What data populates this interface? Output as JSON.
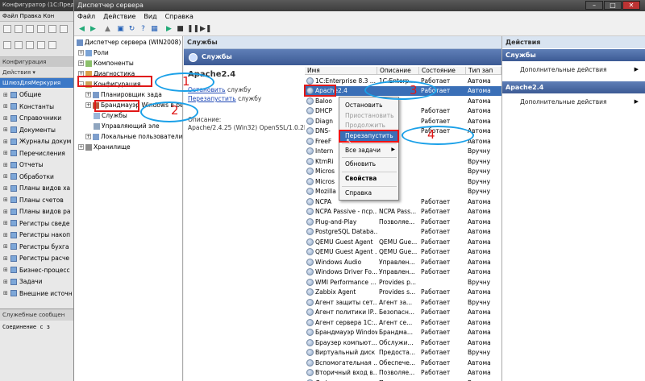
{
  "onec": {
    "title1": "Конфигуратор (1С:Предприятие)",
    "title2": "Файл Правка Кон",
    "panel_header": "Конфигурация",
    "actions_label": "Действия ▾",
    "selected": "ШлюзДляМеркурия",
    "items": [
      "Общие",
      "Константы",
      "Справочники",
      "Документы",
      "Журналы докум",
      "Перечисления",
      "Отчеты",
      "Обработки",
      "Планы видов ха",
      "Планы счетов",
      "Планы видов ра",
      "Регистры сведе",
      "Регистры накоп",
      "Регистры бухга",
      "Регистры расче",
      "Бизнес-процесс",
      "Задачи",
      "Внешние источн"
    ],
    "messages_header": "Служебные сообщен",
    "messages_text": "Соединение с з"
  },
  "window": {
    "title": "Диспетчер сервера",
    "menu": [
      "Файл",
      "Действие",
      "Вид",
      "Справка"
    ],
    "min": "–",
    "max": "□",
    "close": "✕"
  },
  "tree": {
    "root": "Диспетчер сервера (WIN2008)",
    "roles": "Роли",
    "components": "Компоненты",
    "diagnostics": "Диагностика",
    "configuration": "Конфигурация",
    "scheduler": "Планировщик зада",
    "firewall": "Брандмауэр Windows в ре",
    "services": "Службы",
    "wmi": "Управляющий эле",
    "local_users": "Локальные пользователи",
    "storage": "Хранилище"
  },
  "middle": {
    "header": "Службы",
    "bar": "Службы",
    "service_name": "Apache2.4",
    "stop_link": "Остановить",
    "stop_suffix": " службу",
    "restart_link": "Перезапустить",
    "restart_suffix": " службу",
    "desc_label": "Описание:",
    "desc_value": "Apache/2.4.25 (Win32) OpenSSL/1.0.2k"
  },
  "columns": [
    "Имя",
    "Описание",
    "Состояние",
    "Тип зап"
  ],
  "services": [
    {
      "name": "1C:Enterprise 8.3 ...",
      "desc": "1C:Enterp...",
      "state": "Работает",
      "type": "Автома"
    },
    {
      "name": "Apache2.4",
      "desc": "",
      "state": "Работает",
      "type": "Автома"
    },
    {
      "name": "Baloo",
      "desc": "",
      "state": "",
      "type": "Автома"
    },
    {
      "name": "DHCP",
      "desc": "",
      "state": "Работает",
      "type": "Автома"
    },
    {
      "name": "Diagn",
      "desc": "",
      "state": "Работает",
      "type": "Автома"
    },
    {
      "name": "DNS-",
      "desc": "",
      "state": "Работает",
      "type": "Автома"
    },
    {
      "name": "FreeF",
      "desc": "",
      "state": "",
      "type": "Автома"
    },
    {
      "name": "Intern",
      "desc": "",
      "state": "",
      "type": "Вручну"
    },
    {
      "name": "KtmRi",
      "desc": "",
      "state": "",
      "type": "Вручну"
    },
    {
      "name": "Micros",
      "desc": "",
      "state": "",
      "type": "Вручну"
    },
    {
      "name": "Micros",
      "desc": "",
      "state": "",
      "type": "Вручну"
    },
    {
      "name": "Mozilla",
      "desc": "",
      "state": "",
      "type": "Вручну"
    },
    {
      "name": "NCPA",
      "desc": "",
      "state": "Работает",
      "type": "Автома"
    },
    {
      "name": "NCPA Passive - пср...",
      "desc": "NCPA Pass...",
      "state": "Работает",
      "type": "Автома"
    },
    {
      "name": "Plug-and-Play",
      "desc": "Позволяе...",
      "state": "Работает",
      "type": "Автома"
    },
    {
      "name": "PostgreSQL Databa...",
      "desc": "",
      "state": "Работает",
      "type": "Автома"
    },
    {
      "name": "QEMU Guest Agent",
      "desc": "QEMU Gue...",
      "state": "Работает",
      "type": "Автома"
    },
    {
      "name": "QEMU Guest Agent ...",
      "desc": "QEMU Gue...",
      "state": "Работает",
      "type": "Автома"
    },
    {
      "name": "Windows Audio",
      "desc": "Управлен...",
      "state": "Работает",
      "type": "Автома"
    },
    {
      "name": "Windows Driver Fo...",
      "desc": "Управлен...",
      "state": "Работает",
      "type": "Автома"
    },
    {
      "name": "WMI Performance ...",
      "desc": "Provides p...",
      "state": "",
      "type": "Вручну"
    },
    {
      "name": "Zabbix Agent",
      "desc": "Provides s...",
      "state": "Работает",
      "type": "Автома"
    },
    {
      "name": "Агент защиты сет...",
      "desc": "Агент за...",
      "state": "Работает",
      "type": "Вручну"
    },
    {
      "name": "Агент политики IP...",
      "desc": "Безопасн...",
      "state": "Работает",
      "type": "Автома"
    },
    {
      "name": "Агент сервера 1С:...",
      "desc": "Агент се...",
      "state": "Работает",
      "type": "Автома"
    },
    {
      "name": "Брандмауэр Windows",
      "desc": "Брандма...",
      "state": "Работает",
      "type": "Автома"
    },
    {
      "name": "Браузер компьют...",
      "desc": "Обслужи...",
      "state": "Работает",
      "type": "Автома"
    },
    {
      "name": "Виртуальный диск",
      "desc": "Предоста...",
      "state": "Работает",
      "type": "Вручну"
    },
    {
      "name": "Вспомогательная ...",
      "desc": "Обеспече...",
      "state": "Работает",
      "type": "Автома"
    },
    {
      "name": "Вторичный вход в...",
      "desc": "Позволяе...",
      "state": "Работает",
      "type": "Автома"
    },
    {
      "name": "Дефрагментация ...",
      "desc": "Предоста...",
      "state": "",
      "type": "Вручну"
    }
  ],
  "context_menu": {
    "stop": "Остановить",
    "pause": "Приостановить",
    "resume": "Продолжить",
    "restart": "Перезапустить",
    "all_tasks": "Все задачи",
    "refresh": "Обновить",
    "properties": "Свойства",
    "help": "Справка"
  },
  "actions": {
    "header": "Действия",
    "group1": "Службы",
    "more1": "Дополнительные действия",
    "group2": "Apache2.4",
    "more2": "Дополнительные действия"
  },
  "annotations": {
    "n1": "1",
    "n2": "2",
    "n3": "3",
    "n4": "4"
  },
  "colors": {
    "highlight": "#3a6fb7",
    "annotation_red": "#e01818",
    "annotation_blue": "#1aa0e8"
  }
}
